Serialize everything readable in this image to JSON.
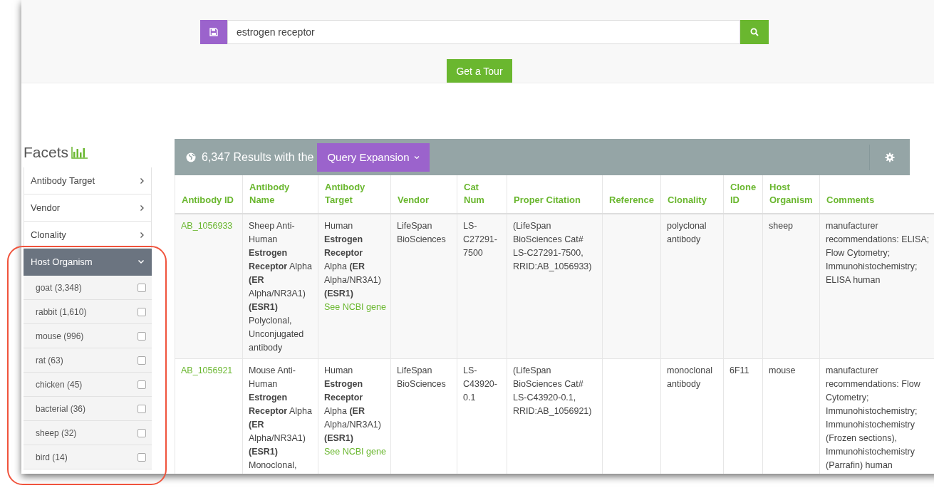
{
  "search": {
    "value": "estrogen receptor"
  },
  "tour_button": "Get a Tour",
  "facets": {
    "title": "Facets",
    "items": [
      {
        "label": "Antibody Target",
        "expanded": false
      },
      {
        "label": "Vendor",
        "expanded": false
      },
      {
        "label": "Clonality",
        "expanded": false
      },
      {
        "label": "Host Organism",
        "expanded": true,
        "options": [
          {
            "label": "goat (3,348)",
            "checked": false
          },
          {
            "label": "rabbit (1,610)",
            "checked": false
          },
          {
            "label": "mouse (996)",
            "checked": false
          },
          {
            "label": "rat (63)",
            "checked": false
          },
          {
            "label": "chicken (45)",
            "checked": false
          },
          {
            "label": "bacterial (36)",
            "checked": false
          },
          {
            "label": "sheep (32)",
            "checked": false
          },
          {
            "label": "bird (14)",
            "checked": false
          }
        ]
      }
    ]
  },
  "results": {
    "summary": "6,347 Results with the",
    "expansion_button": "Query Expansion",
    "table": {
      "columns": [
        "Antibody ID",
        "Antibody Name",
        "Antibody Target",
        "Vendor",
        "Cat Num",
        "Proper Citation",
        "Reference",
        "Clonality",
        "Clone ID",
        "Host Organism",
        "Comments"
      ],
      "rows": [
        {
          "cells": [
            {
              "link": "AB_1056933"
            },
            {
              "text": "Sheep Anti-Human **Estrogen Receptor** Alpha **(ER** Alpha/NR3A1) **(ESR1)** Polyclonal, Unconjugated antibody"
            },
            {
              "text": "Human **Estrogen Receptor** Alpha **(ER** Alpha/NR3A1) **(ESR1)**",
              "link": "See NCBI gene"
            },
            {
              "text": "LifeSpan BioSciences"
            },
            {
              "text": "LS-C27291-7500"
            },
            {
              "text": "(LifeSpan BioSciences Cat# LS-C27291-7500, RRID:AB_1056933)"
            },
            {},
            {
              "text": "polyclonal antibody"
            },
            {},
            {
              "text": "sheep"
            },
            {
              "text": "manufacturer recommendations: ELISA; Flow Cytometry; Immunohistochemistry; ELISA human"
            }
          ]
        },
        {
          "cells": [
            {
              "link": "AB_1056921"
            },
            {
              "text": "Mouse Anti-Human **Estrogen Receptor** Alpha **(ER** Alpha/NR3A1) **(ESR1)** Monoclonal,"
            },
            {
              "text": "Human **Estrogen Receptor** Alpha **(ER** Alpha/NR3A1) **(ESR1)**",
              "link": "See NCBI gene"
            },
            {
              "text": "LifeSpan BioSciences"
            },
            {
              "text": "LS-C43920-0.1"
            },
            {
              "text": "(LifeSpan BioSciences Cat# LS-C43920-0.1, RRID:AB_1056921)"
            },
            {},
            {
              "text": "monoclonal antibody"
            },
            {
              "text": "6F11"
            },
            {
              "text": "mouse"
            },
            {
              "text": "manufacturer recommendations: Flow Cytometry; Immunohistochemistry; Immunohistochemistry (Frozen sections), Immunohistochemistry (Parrafin) human"
            }
          ]
        }
      ]
    }
  }
}
